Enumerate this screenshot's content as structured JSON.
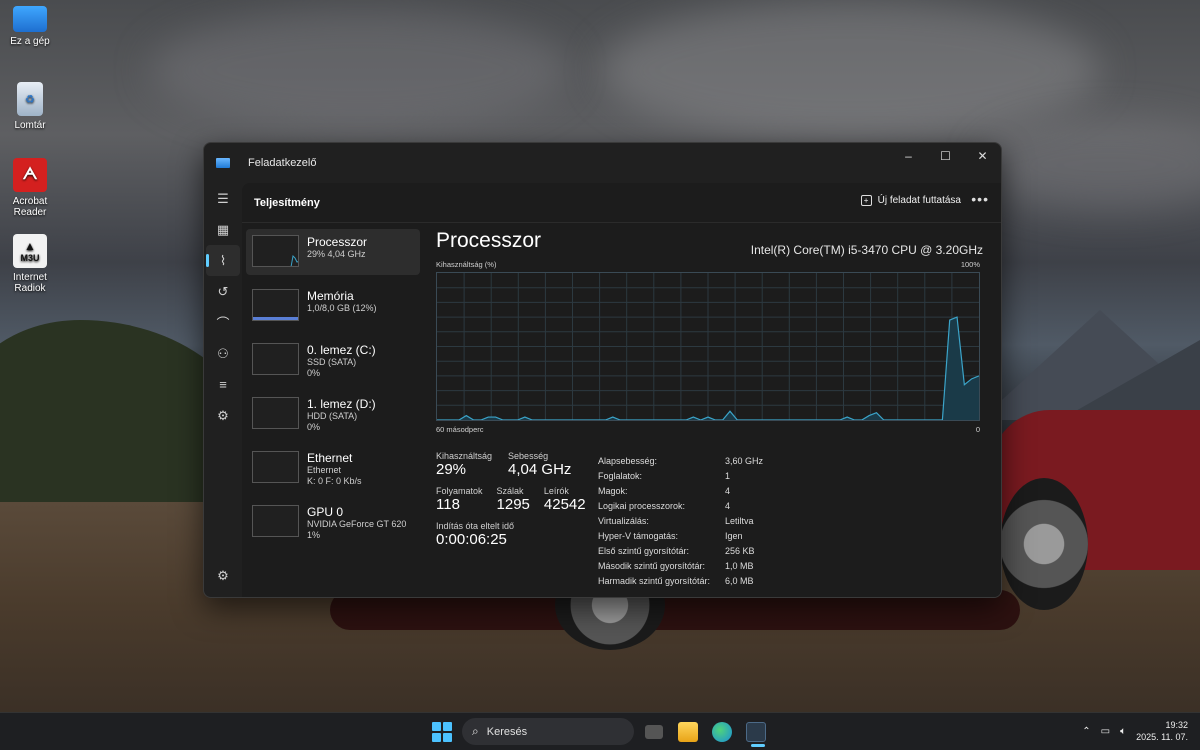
{
  "desktop": {
    "icons": [
      {
        "label": "Ez a gép",
        "icon": "monitor-icon"
      },
      {
        "label": "Lomtár",
        "icon": "recycle-bin-icon"
      },
      {
        "label": "Acrobat Reader",
        "icon": "acrobat-icon"
      },
      {
        "label": "Internet Radiok",
        "icon": "m3u-icon",
        "badge": "M3U"
      }
    ]
  },
  "window": {
    "title": "Feladatkezelő",
    "controls": {
      "minimize": "–",
      "maximize": "☐",
      "close": "✕"
    },
    "section_title": "Teljesítmény",
    "run_task_label": "Új feladat futtatása",
    "more_label": "•••",
    "accent": "#60cdff",
    "nav": [
      {
        "name": "hamburger-icon",
        "glyph": "☰"
      },
      {
        "name": "processes-icon",
        "glyph": "▦"
      },
      {
        "name": "performance-icon",
        "glyph": "⌇",
        "active": true
      },
      {
        "name": "app-history-icon",
        "glyph": "↺"
      },
      {
        "name": "startup-apps-icon",
        "glyph": "⌒"
      },
      {
        "name": "users-icon",
        "glyph": "⚇"
      },
      {
        "name": "details-icon",
        "glyph": "≡"
      },
      {
        "name": "services-icon",
        "glyph": "⚙"
      }
    ],
    "settings_glyph": "⚙"
  },
  "resources": [
    {
      "name": "Processzor",
      "sub1": "29%  4,04 GHz",
      "sub2": "",
      "active": true
    },
    {
      "name": "Memória",
      "sub1": "1,0/8,0 GB (12%)",
      "sub2": ""
    },
    {
      "name": "0. lemez (C:)",
      "sub1": "SSD (SATA)",
      "sub2": "0%"
    },
    {
      "name": "1. lemez (D:)",
      "sub1": "HDD (SATA)",
      "sub2": "0%"
    },
    {
      "name": "Ethernet",
      "sub1": "Ethernet",
      "sub2": "K: 0 F: 0 Kb/s"
    },
    {
      "name": "GPU 0",
      "sub1": "NVIDIA GeForce GT 620",
      "sub2": "1%"
    }
  ],
  "cpu": {
    "title": "Processzor",
    "model": "Intel(R) Core(TM) i5-3470 CPU @ 3.20GHz",
    "graph_label": "Kihasználtság (%)",
    "graph_max": "100%",
    "graph_span": "60 másodperc",
    "graph_min": "0",
    "stats": {
      "utilization_label": "Kihasználtság",
      "utilization": "29%",
      "speed_label": "Sebesség",
      "speed": "4,04 GHz",
      "processes_label": "Folyamatok",
      "processes": "118",
      "threads_label": "Szálak",
      "threads": "1295",
      "handles_label": "Leírók",
      "handles": "42542",
      "uptime_label": "Indítás óta eltelt idő",
      "uptime": "0:00:06:25"
    },
    "properties": [
      {
        "key": "Alapsebesség:",
        "value": "3,60 GHz"
      },
      {
        "key": "Foglalatok:",
        "value": "1"
      },
      {
        "key": "Magok:",
        "value": "4"
      },
      {
        "key": "Logikai processzorok:",
        "value": "4"
      },
      {
        "key": "Virtualizálás:",
        "value": "Letiltva"
      },
      {
        "key": "Hyper-V támogatás:",
        "value": "Igen"
      },
      {
        "key": "Első szintű gyorsítótár:",
        "value": "256 KB"
      },
      {
        "key": "Második szintű gyorsítótár:",
        "value": "1,0 MB"
      },
      {
        "key": "Harmadik szintű gyorsítótár:",
        "value": "6,0 MB"
      }
    ],
    "usage_history": [
      0,
      0,
      0,
      0,
      3,
      0,
      0,
      2,
      2,
      0,
      0,
      0,
      2,
      0,
      0,
      0,
      0,
      0,
      0,
      0,
      0,
      0,
      0,
      0,
      2,
      0,
      0,
      0,
      0,
      0,
      0,
      0,
      0,
      0,
      0,
      2,
      0,
      2,
      0,
      0,
      6,
      0,
      0,
      0,
      0,
      0,
      0,
      0,
      0,
      0,
      0,
      0,
      0,
      0,
      0,
      0,
      2,
      0,
      0,
      3,
      5,
      0,
      0,
      0,
      0,
      0,
      0,
      0,
      0,
      0,
      68,
      70,
      24,
      28,
      30
    ],
    "line_color": "#3ba4c9",
    "fill_color": "#1a3a48"
  },
  "taskbar": {
    "search_label": "Keresés",
    "time": "19:32",
    "date": "2025. 11. 07.",
    "tray": [
      "chevron-up-icon",
      "network-icon",
      "volume-icon"
    ]
  }
}
